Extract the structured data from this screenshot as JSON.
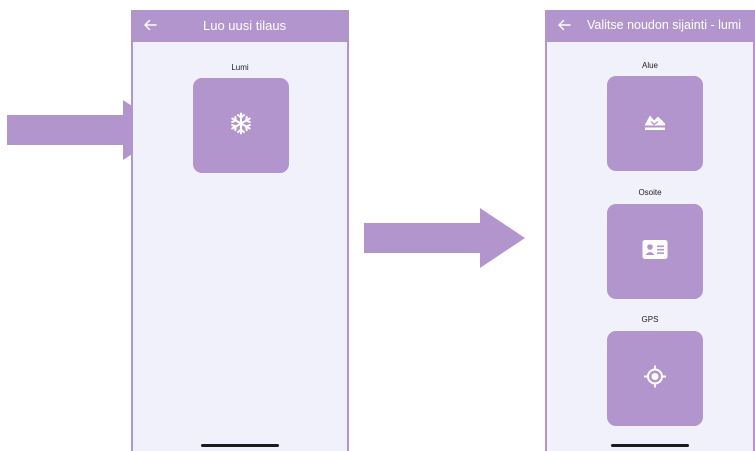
{
  "screens": {
    "left": {
      "title": "Luo uusi tilaus",
      "back_icon": "arrow-left-icon",
      "tiles": [
        {
          "label": "Lumi",
          "icon": "snowflake-icon"
        }
      ]
    },
    "right": {
      "title": "Valitse noudon sijainti - lumi",
      "back_icon": "arrow-left-icon",
      "tiles": [
        {
          "label": "Alue",
          "icon": "area-map-icon"
        },
        {
          "label": "Osoite",
          "icon": "address-card-icon"
        },
        {
          "label": "GPS",
          "icon": "gps-location-icon"
        }
      ]
    }
  },
  "colors": {
    "accent": "#b395cd",
    "screen_background": "#f0f1fa",
    "page_background": "#ffffff"
  }
}
